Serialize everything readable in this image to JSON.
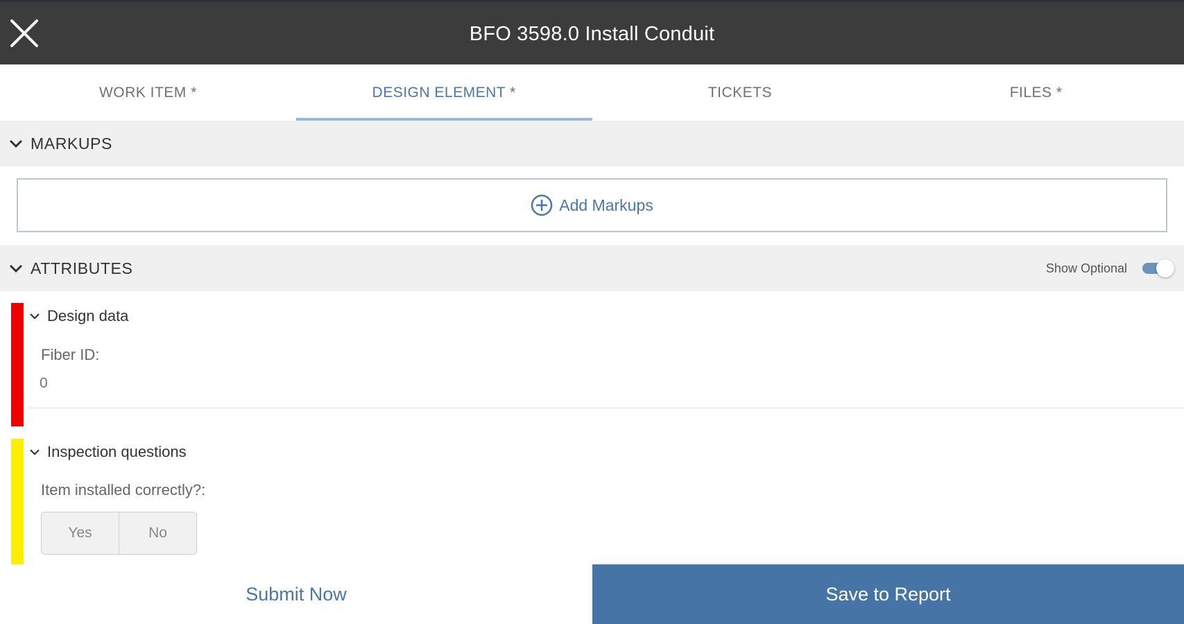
{
  "header": {
    "title": "BFO 3598.0 Install Conduit",
    "close_icon": "close-icon",
    "background": "#3c3c3c"
  },
  "tabs": [
    {
      "label": "WORK ITEM *",
      "active": false
    },
    {
      "label": "DESIGN ELEMENT *",
      "active": true
    },
    {
      "label": "TICKETS",
      "active": false
    },
    {
      "label": "FILES *",
      "active": false
    }
  ],
  "markups": {
    "header": "MARKUPS",
    "add_label": "Add Markups",
    "add_icon": "plus-circle-icon"
  },
  "attributes": {
    "header": "ATTRIBUTES",
    "show_optional_label": "Show Optional",
    "show_optional_on": true,
    "groups": [
      {
        "title": "Design data",
        "status_color": "#ee0000",
        "fields": [
          {
            "label": "Fiber ID:",
            "value": "0"
          }
        ]
      },
      {
        "title": "Inspection questions",
        "status_color": "#ffee00",
        "fields": [
          {
            "label": "Item installed correctly?:",
            "options": [
              "Yes",
              "No"
            ]
          }
        ]
      }
    ]
  },
  "footer": {
    "submit_label": "Submit Now",
    "save_label": "Save to Report",
    "accent": "#4774a6"
  }
}
